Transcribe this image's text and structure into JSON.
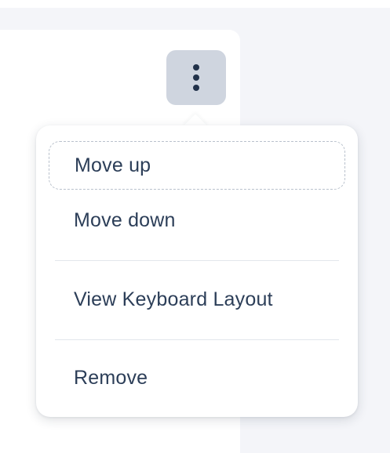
{
  "colors": {
    "page_background": "#f4f5f9",
    "card_background": "#ffffff",
    "kebab_background": "#cfd5df",
    "kebab_dots": "#22324a",
    "menu_text": "#2c3e58",
    "focus_outline": "#b9c1cc",
    "divider": "#e2e6ec"
  },
  "kebab_button": {
    "icon": "more-vertical-icon"
  },
  "menu": {
    "items": [
      {
        "label": "Move up",
        "focused": true
      },
      {
        "label": "Move down",
        "focused": false
      },
      {
        "label": "View Keyboard Layout",
        "focused": false
      },
      {
        "label": "Remove",
        "focused": false
      }
    ]
  }
}
